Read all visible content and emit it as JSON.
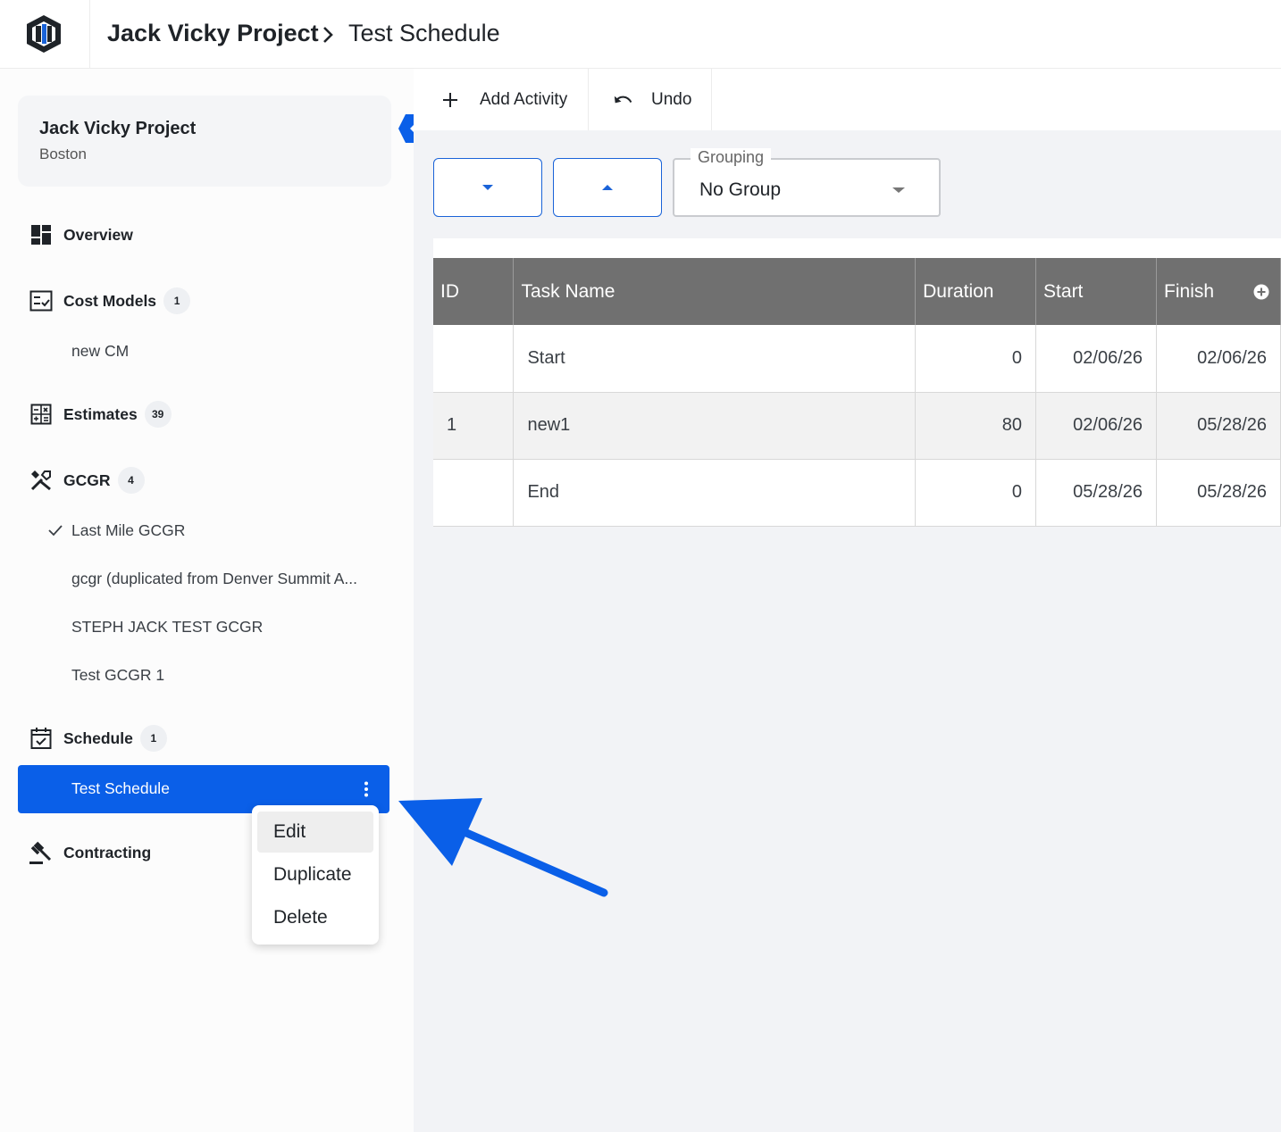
{
  "header": {
    "project": "Jack Vicky Project",
    "current": "Test Schedule"
  },
  "sidebar": {
    "project_card": {
      "name": "Jack Vicky Project",
      "location": "Boston"
    },
    "sections": {
      "overview": {
        "label": "Overview"
      },
      "cost_models": {
        "label": "Cost Models",
        "count": "1",
        "items": [
          "new CM"
        ]
      },
      "estimates": {
        "label": "Estimates",
        "count": "39"
      },
      "gcgr": {
        "label": "GCGR",
        "count": "4",
        "items": [
          "Last Mile GCGR",
          "gcgr (duplicated from Denver Summit A...",
          "STEPH JACK TEST GCGR",
          "Test GCGR 1"
        ]
      },
      "schedule": {
        "label": "Schedule",
        "count": "1",
        "items": [
          "Test Schedule"
        ]
      },
      "contracting": {
        "label": "Contracting"
      }
    }
  },
  "toolbar": {
    "add_label": "Add Activity",
    "undo_label": "Undo"
  },
  "grouping": {
    "label": "Grouping",
    "value": "No Group"
  },
  "table": {
    "columns": [
      "ID",
      "Task Name",
      "Duration",
      "Start",
      "Finish"
    ],
    "rows": [
      {
        "id": "",
        "name": "Start",
        "duration": "0",
        "start": "02/06/26",
        "finish": "02/06/26"
      },
      {
        "id": "1",
        "name": "new1",
        "duration": "80",
        "start": "02/06/26",
        "finish": "05/28/26"
      },
      {
        "id": "",
        "name": "End",
        "duration": "0",
        "start": "05/28/26",
        "finish": "05/28/26"
      }
    ]
  },
  "context_menu": {
    "items": [
      "Edit",
      "Duplicate",
      "Delete"
    ]
  },
  "colors": {
    "accent": "#0a5fe8",
    "header_gray": "#707070",
    "arrow": "#0a5fe8"
  },
  "icons": [
    "logo-icon",
    "chevron-right-icon",
    "dashboard-icon",
    "checklist-icon",
    "calculator-icon",
    "tools-icon",
    "check-icon",
    "calendar-check-icon",
    "gavel-icon",
    "kebab-icon",
    "collapse-left-icon",
    "plus-icon",
    "undo-icon",
    "caret-down-icon",
    "caret-up-icon",
    "add-circle-icon"
  ]
}
